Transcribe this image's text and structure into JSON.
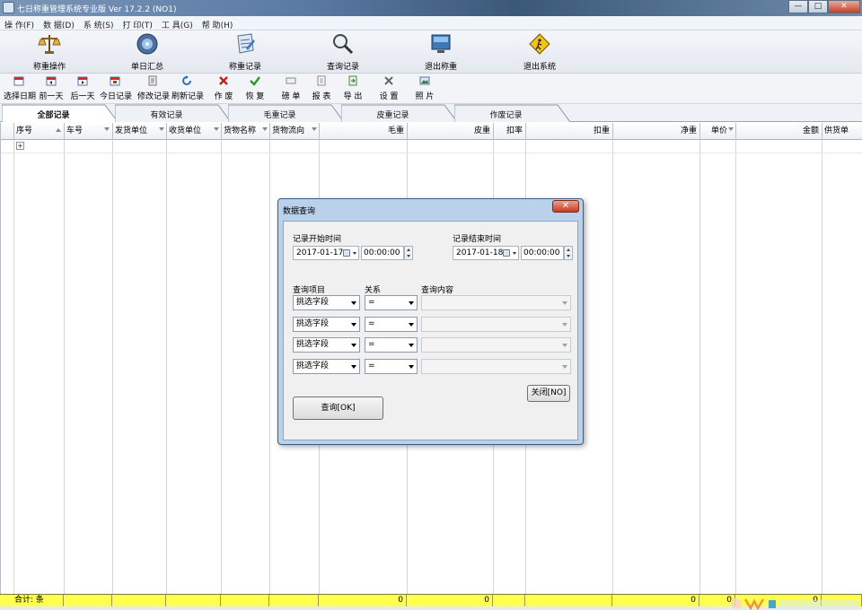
{
  "window": {
    "title": "七日称重管理系统专业版 Ver 17.2.2 (NO1)",
    "minimize": "—",
    "maximize": "□",
    "close": "✕"
  },
  "menu": [
    "操 作(F)",
    "数 据(D)",
    "系 统(S)",
    "打 印(T)",
    "工 具(G)",
    "帮 助(H)"
  ],
  "big_toolbar": [
    {
      "label": "称重操作",
      "icon": "scale-icon"
    },
    {
      "label": "单日汇总",
      "icon": "disc-icon"
    },
    {
      "label": "称重记录",
      "icon": "notebook-icon"
    },
    {
      "label": "查询记录",
      "icon": "magnifier-icon"
    },
    {
      "label": "退出称重",
      "icon": "monitor-icon"
    },
    {
      "label": "退出系统",
      "icon": "exit-sign-icon"
    }
  ],
  "small_toolbar": [
    {
      "label": "选择日期",
      "icon": "calendar-icon"
    },
    {
      "label": "前一天",
      "icon": "calendar-prev-icon"
    },
    {
      "label": "后一天",
      "icon": "calendar-next-icon"
    },
    {
      "label": "今日记录",
      "icon": "calendar-today-icon"
    },
    {
      "label": "修改记录",
      "icon": "edit-icon"
    },
    {
      "label": "刷新记录",
      "icon": "refresh-icon"
    },
    {
      "label": "作 废",
      "icon": "void-x-icon"
    },
    {
      "label": "恢 复",
      "icon": "restore-check-icon"
    },
    {
      "label": "磅 单",
      "icon": "ticket-icon"
    },
    {
      "label": "报 表",
      "icon": "report-icon"
    },
    {
      "label": "导 出",
      "icon": "export-icon"
    },
    {
      "label": "设 置",
      "icon": "settings-tools-icon"
    },
    {
      "label": "照 片",
      "icon": "photo-icon"
    }
  ],
  "tabs": [
    "全部记录",
    "有效记录",
    "毛重记录",
    "皮重记录",
    "作废记录"
  ],
  "active_tab": "全部记录",
  "columns": [
    "序号",
    "车号",
    "发货单位",
    "收货单位",
    "货物名称",
    "货物流向",
    "毛重",
    "皮重",
    "扣率",
    "扣重",
    "净重",
    "单价",
    "金额",
    "供货单"
  ],
  "expander": "+",
  "summary": {
    "label": "合计: 条",
    "gross": "0",
    "tare": "0",
    "net": "0",
    "price": "0",
    "amount": "0"
  },
  "dialog": {
    "title": "数据查询",
    "close": "✕",
    "start_label": "记录开始时间",
    "start_date": "2017-01-17",
    "start_time": "00:00:00",
    "end_label": "记录结束时间",
    "end_date": "2017-01-18",
    "end_time": "00:00:00",
    "field_header": "查询项目",
    "relation_header": "关系",
    "content_header": "查询内容",
    "rows": [
      {
        "field": "挑选字段",
        "relation": "=",
        "content": ""
      },
      {
        "field": "挑选字段",
        "relation": "=",
        "content": ""
      },
      {
        "field": "挑选字段",
        "relation": "=",
        "content": ""
      },
      {
        "field": "挑选字段",
        "relation": "=",
        "content": ""
      }
    ],
    "close_button": "关闭[NO]",
    "query_button": "查询[OK]"
  },
  "colors": {
    "summary_bg": "#ffff4d",
    "dialog_frame": "#b9d1ea",
    "close_red": "#c53b22"
  }
}
